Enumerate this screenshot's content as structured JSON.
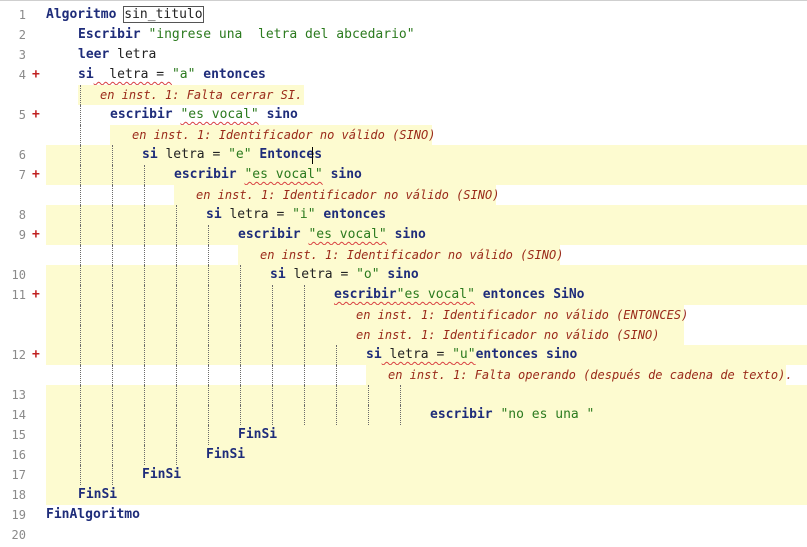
{
  "editor": {
    "lines": [
      {
        "n": "1",
        "marker": "",
        "parts": [
          {
            "t": "Algoritmo",
            "c": "kw"
          },
          {
            "t": " "
          },
          {
            "t": "sin_titulo",
            "c": "txt boxed"
          }
        ]
      },
      {
        "n": "2",
        "marker": "",
        "parts": [
          {
            "t": "Escribir",
            "c": "kw"
          },
          {
            "t": " "
          },
          {
            "t": "\"ingrese una  letra del abcedario\"",
            "c": "str"
          }
        ]
      },
      {
        "n": "3",
        "marker": "",
        "parts": [
          {
            "t": "leer",
            "c": "kw"
          },
          {
            "t": " letra"
          }
        ]
      },
      {
        "n": "4",
        "marker": "+",
        "parts": [
          {
            "t": "si",
            "c": "kw"
          },
          {
            "t": "  letra = ",
            "c": "txt sq"
          },
          {
            "t": "\"a\"",
            "c": "str"
          },
          {
            "t": " "
          },
          {
            "t": "entonces",
            "c": "kw"
          }
        ]
      },
      {
        "n": "",
        "marker": "",
        "error": "en inst. 1: Falta cerrar SI."
      },
      {
        "n": "5",
        "marker": "+",
        "parts": [
          {
            "t": "escribir",
            "c": "kw"
          },
          {
            "t": " "
          },
          {
            "t": "\"es vocal\"",
            "c": "str sq"
          },
          {
            "t": " "
          },
          {
            "t": "sino",
            "c": "kw"
          }
        ]
      },
      {
        "n": "",
        "marker": "",
        "error": "en inst. 1: Identificador no válido (SINO)"
      },
      {
        "n": "6",
        "marker": "",
        "parts": [
          {
            "t": "si",
            "c": "kw"
          },
          {
            "t": " letra = "
          },
          {
            "t": "\"e\"",
            "c": "str"
          },
          {
            "t": " "
          },
          {
            "t": "Entonces",
            "c": "kw"
          }
        ]
      },
      {
        "n": "7",
        "marker": "+",
        "parts": [
          {
            "t": "escribir",
            "c": "kw"
          },
          {
            "t": " "
          },
          {
            "t": "\"es vocal\"",
            "c": "str sq"
          },
          {
            "t": " "
          },
          {
            "t": "sino",
            "c": "kw"
          }
        ]
      },
      {
        "n": "",
        "marker": "",
        "error": "en inst. 1: Identificador no válido (SINO)"
      },
      {
        "n": "8",
        "marker": "",
        "parts": [
          {
            "t": "si",
            "c": "kw"
          },
          {
            "t": " letra = "
          },
          {
            "t": "\"i\"",
            "c": "str"
          },
          {
            "t": " "
          },
          {
            "t": "entonces",
            "c": "kw"
          }
        ]
      },
      {
        "n": "9",
        "marker": "+",
        "parts": [
          {
            "t": "escribir",
            "c": "kw"
          },
          {
            "t": " "
          },
          {
            "t": "\"es vocal\"",
            "c": "str sq"
          },
          {
            "t": " "
          },
          {
            "t": "sino",
            "c": "kw"
          }
        ]
      },
      {
        "n": "",
        "marker": "",
        "error": "en inst. 1: Identificador no válido (SINO)"
      },
      {
        "n": "10",
        "marker": "",
        "parts": [
          {
            "t": "si",
            "c": "kw"
          },
          {
            "t": " letra = "
          },
          {
            "t": "\"o\"",
            "c": "str"
          },
          {
            "t": " "
          },
          {
            "t": "sino",
            "c": "kw"
          }
        ]
      },
      {
        "n": "11",
        "marker": "+",
        "parts": [
          {
            "t": "escribir",
            "c": "kw sq"
          },
          {
            "t": "\"es vocal\"",
            "c": "str sq"
          },
          {
            "t": " "
          },
          {
            "t": "entonces",
            "c": "kw"
          },
          {
            "t": " "
          },
          {
            "t": "SiNo",
            "c": "kw"
          }
        ]
      },
      {
        "n": "",
        "marker": "",
        "error": "en inst. 1: Identificador no válido (ENTONCES)"
      },
      {
        "n": "",
        "marker": "",
        "error": "en inst. 1: Identificador no válido (SINO)"
      },
      {
        "n": "12",
        "marker": "+",
        "parts": [
          {
            "t": "si",
            "c": "kw"
          },
          {
            "t": " letra = ",
            "c": "txt sq"
          },
          {
            "t": "\"u\"",
            "c": "str sq"
          },
          {
            "t": "entonces",
            "c": "kw"
          },
          {
            "t": " "
          },
          {
            "t": "sino",
            "c": "kw"
          }
        ]
      },
      {
        "n": "",
        "marker": "",
        "error": "en inst. 1: Falta operando (después de cadena de texto)."
      },
      {
        "n": "13",
        "marker": "",
        "parts": []
      },
      {
        "n": "14",
        "marker": "",
        "parts": [
          {
            "t": "escribir",
            "c": "kw"
          },
          {
            "t": " "
          },
          {
            "t": "\"no es una \"",
            "c": "str"
          }
        ]
      },
      {
        "n": "15",
        "marker": "",
        "parts": [
          {
            "t": "FinSi",
            "c": "kw"
          }
        ]
      },
      {
        "n": "16",
        "marker": "",
        "parts": [
          {
            "t": "FinSi",
            "c": "kw"
          }
        ]
      },
      {
        "n": "17",
        "marker": "",
        "parts": [
          {
            "t": "FinSi",
            "c": "kw"
          }
        ]
      },
      {
        "n": "18",
        "marker": "",
        "parts": [
          {
            "t": "FinSi",
            "c": "kw"
          }
        ]
      },
      {
        "n": "19",
        "marker": "",
        "parts": [
          {
            "t": "FinAlgoritmo",
            "c": "kw"
          }
        ]
      },
      {
        "n": "20",
        "marker": "",
        "parts": []
      }
    ]
  }
}
